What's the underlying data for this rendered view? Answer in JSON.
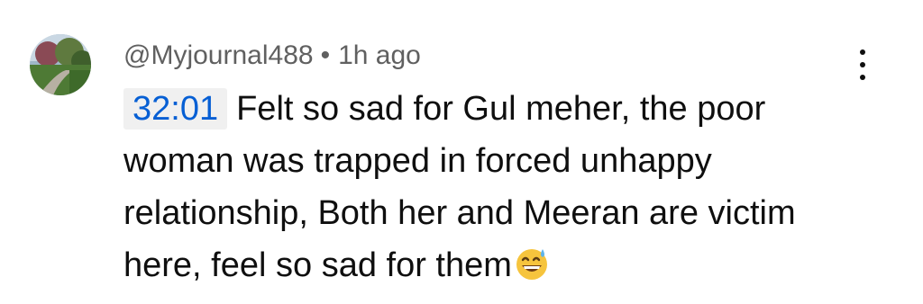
{
  "comment": {
    "author": "@Myjournal488",
    "separator": "•",
    "time_ago": "1h ago",
    "timestamp_link": "32:01",
    "text": "Felt so sad for Gul meher, the poor woman was trapped in forced unhappy relationship, Both her and Meeran are victim here, feel so sad for them",
    "emoji": "grinning-face-with-sweat-icon"
  },
  "colors": {
    "timestamp_link": "#065fd4",
    "timestamp_bg": "#f0f0f0",
    "meta_text": "#606060",
    "body_text": "#0f0f0f"
  },
  "icons": {
    "menu": "more-vert-icon",
    "avatar": "park-photo-avatar"
  }
}
